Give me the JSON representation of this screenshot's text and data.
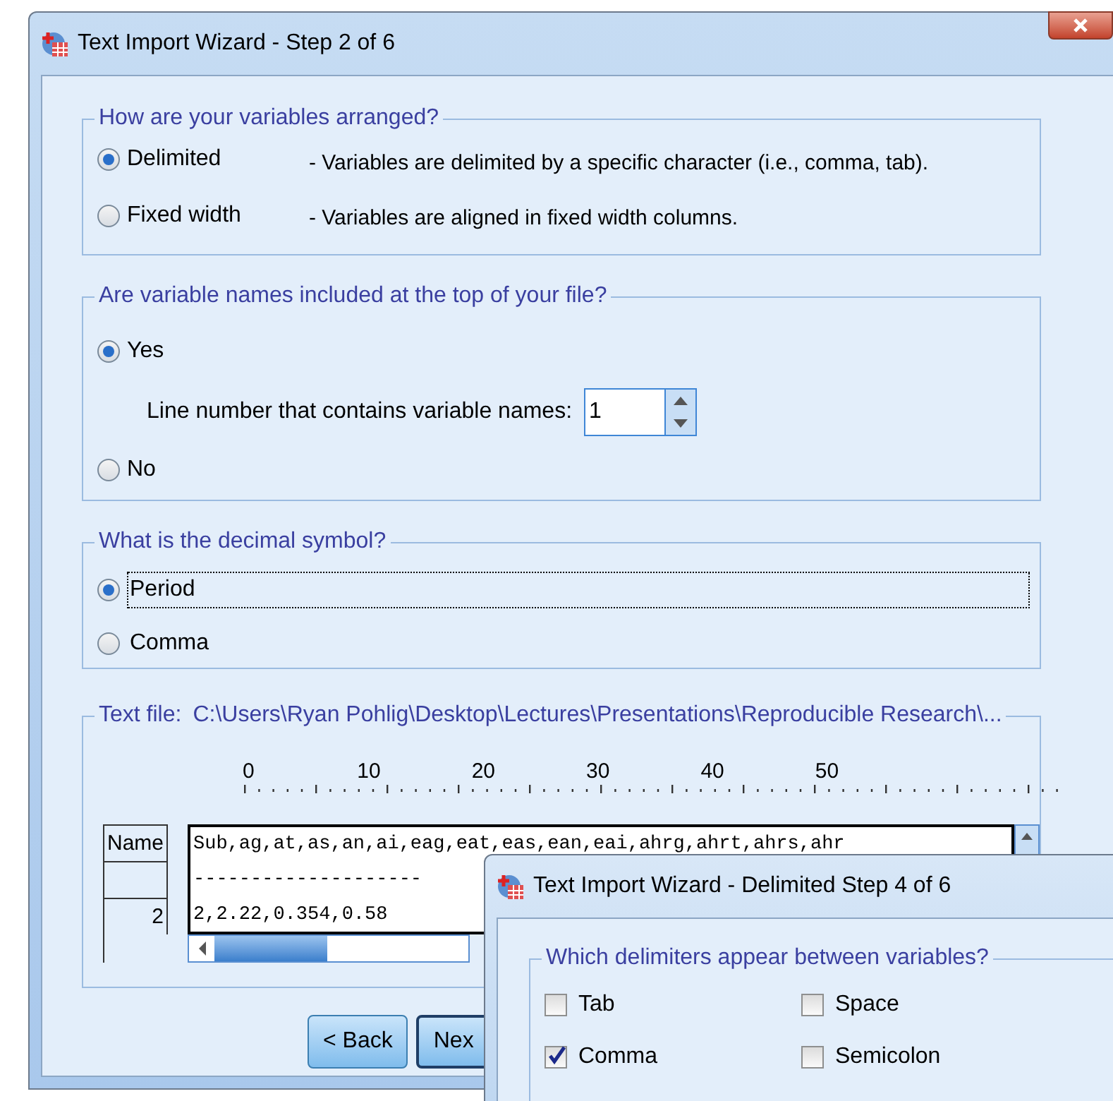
{
  "window": {
    "title": "Text Import Wizard - Step 2 of 6"
  },
  "arrangement": {
    "legend": "How are your variables arranged?",
    "options": [
      {
        "label": "Delimited",
        "description": "- Variables are delimited by a specific character (i.e., comma, tab).",
        "selected": true
      },
      {
        "label": "Fixed width",
        "description": "- Variables are aligned in fixed width columns.",
        "selected": false
      }
    ]
  },
  "names_group": {
    "legend": "Are variable names included at the top of your file?",
    "yes": {
      "label": "Yes",
      "selected": true
    },
    "line_label": "Line number that contains variable names:",
    "line_value": "1",
    "no": {
      "label": "No",
      "selected": false
    }
  },
  "decimal": {
    "legend": "What is the decimal symbol?",
    "options": [
      {
        "label": "Period",
        "selected": true,
        "focused": true
      },
      {
        "label": "Comma",
        "selected": false,
        "focused": false
      }
    ]
  },
  "text_file": {
    "legend": "Text file:",
    "path": "C:\\Users\\Ryan Pohlig\\Desktop\\Lectures\\Presentations\\Reproducible Research\\...",
    "ruler": [
      "0",
      "10",
      "20",
      "30",
      "40",
      "50"
    ],
    "rows": [
      {
        "header": "Name",
        "line": "Sub,ag,at,as,an,ai,eag,eat,eas,ean,eai,ahrg,ahrt,ahrs,ahr"
      },
      {
        "line": "--------------------"
      },
      {
        "header": "2",
        "line": "2,2.22,0.354,0.58"
      }
    ]
  },
  "buttons": [
    "< Back",
    "Nex"
  ],
  "dialog": {
    "title": "Text Import Wizard - Delimited Step 4 of 6",
    "legend": "Which delimiters appear between variables?",
    "delimiters": [
      {
        "label": "Tab",
        "checked": false
      },
      {
        "label": "Space",
        "checked": false
      },
      {
        "label": "Comma",
        "checked": true
      },
      {
        "label": "Semicolon",
        "checked": false
      }
    ]
  }
}
